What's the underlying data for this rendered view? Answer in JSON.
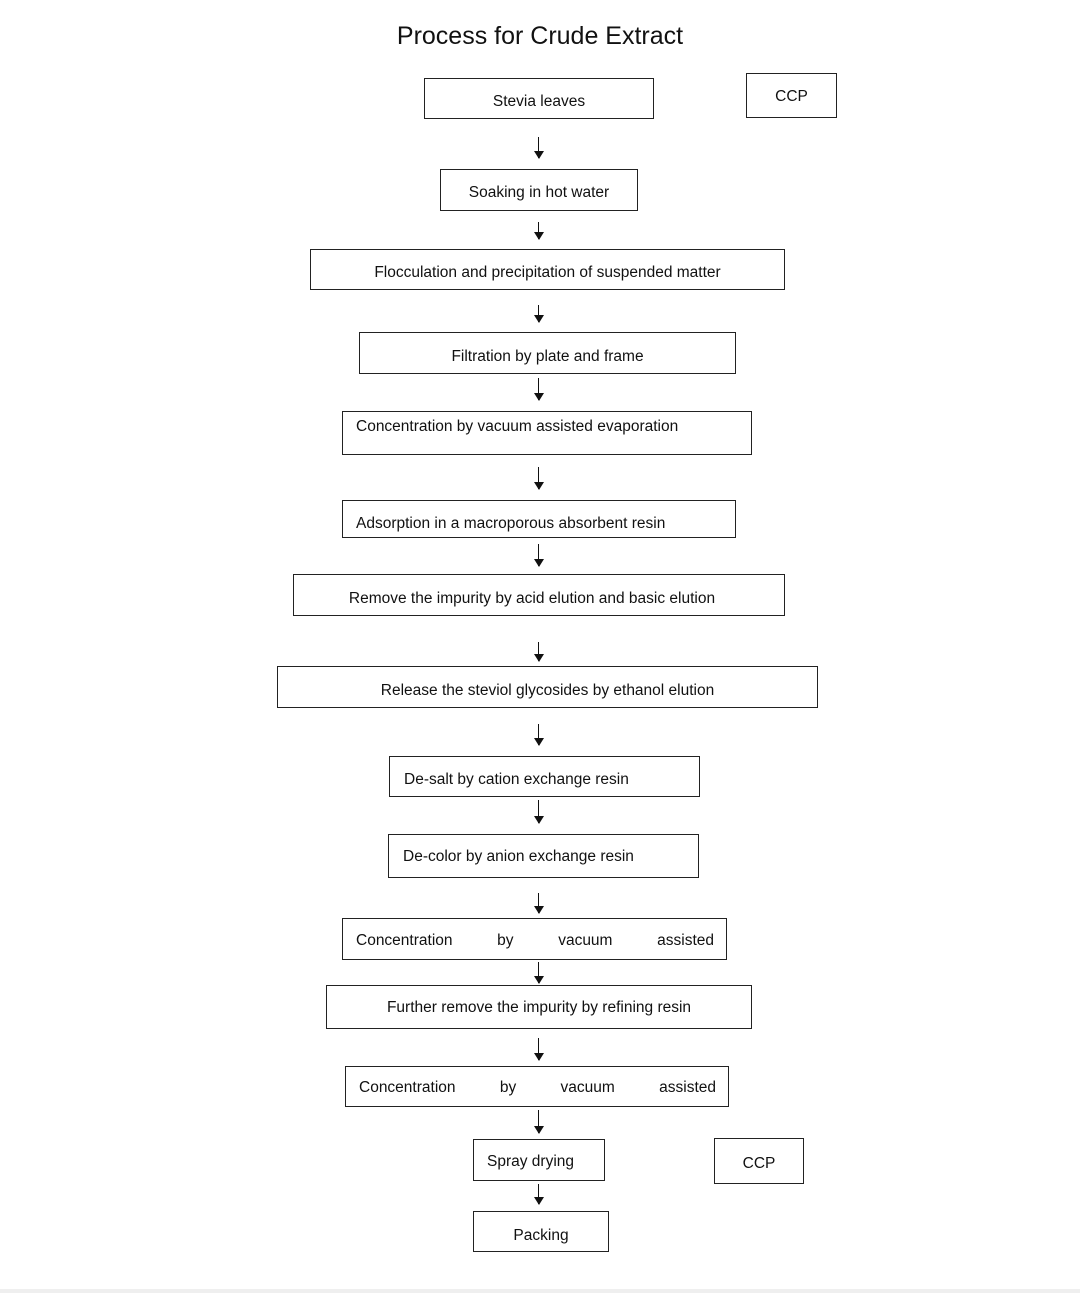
{
  "title": "Process for Crude Extract",
  "steps": [
    "Stevia leaves",
    "Soaking in hot water",
    "Flocculation and precipitation of suspended matter",
    "Filtration by plate and frame",
    "Concentration by vacuum assisted evaporation",
    "Adsorption in a macroporous absorbent resin",
    "Remove the impurity by acid elution and basic elution",
    "Release the steviol glycosides by ethanol elution",
    "De-salt by cation exchange resin",
    "De-color by anion exchange resin",
    "Concentration by vacuum assisted",
    "Further remove the impurity by refining resin",
    "Concentration by vacuum assisted",
    "Spray drying",
    "Packing"
  ],
  "ccp_labels": [
    "CCP",
    "CCP"
  ]
}
